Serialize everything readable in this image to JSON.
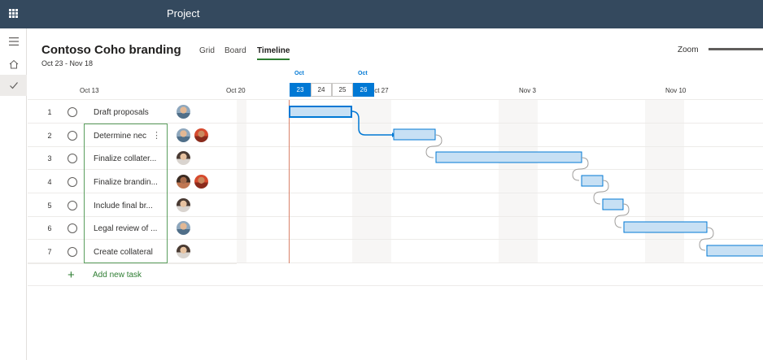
{
  "header": {
    "app_title": "Project",
    "icon": "waffle-icon"
  },
  "rail": {
    "items": [
      {
        "name": "menu",
        "icon": "hamburger-icon"
      },
      {
        "name": "home",
        "icon": "home-icon"
      },
      {
        "name": "my-tasks",
        "icon": "checkmark-icon",
        "active": true
      }
    ]
  },
  "plan": {
    "title": "Contoso Coho branding",
    "dates": "Oct 23 - Nov 18"
  },
  "views": [
    "Grid",
    "Board",
    "Timeline"
  ],
  "selected_view": "Timeline",
  "zoom": {
    "label": "Zoom"
  },
  "timeline": {
    "week_labels": [
      "Oct 13",
      "Oct 20",
      "Oct 27",
      "Nov 3",
      "Nov 10"
    ],
    "month_labels": [
      "Oct",
      "Oct"
    ],
    "days": [
      "23",
      "24",
      "25",
      "26"
    ]
  },
  "tasks": [
    {
      "num": "1",
      "name": "Draft proposals",
      "avatars": [
        "a1"
      ]
    },
    {
      "num": "2",
      "name": "Determine nec",
      "avatars": [
        "a1",
        "a2"
      ]
    },
    {
      "num": "3",
      "name": "Finalize collater...",
      "avatars": [
        "a3"
      ]
    },
    {
      "num": "4",
      "name": "Finalize brandin...",
      "avatars": [
        "a4",
        "a2"
      ]
    },
    {
      "num": "5",
      "name": "Include final br...",
      "avatars": [
        "a3"
      ]
    },
    {
      "num": "6",
      "name": "Legal review of ...",
      "avatars": [
        "a1"
      ]
    },
    {
      "num": "7",
      "name": "Create collateral",
      "avatars": [
        "a3"
      ]
    }
  ],
  "add_task": {
    "label": "Add new task"
  },
  "colors": {
    "header_bg": "#34495e",
    "accent_green": "#2e7d32",
    "accent_blue": "#0078d4",
    "bar_fill": "#c7e0f4",
    "today_line": "#d9826a"
  }
}
